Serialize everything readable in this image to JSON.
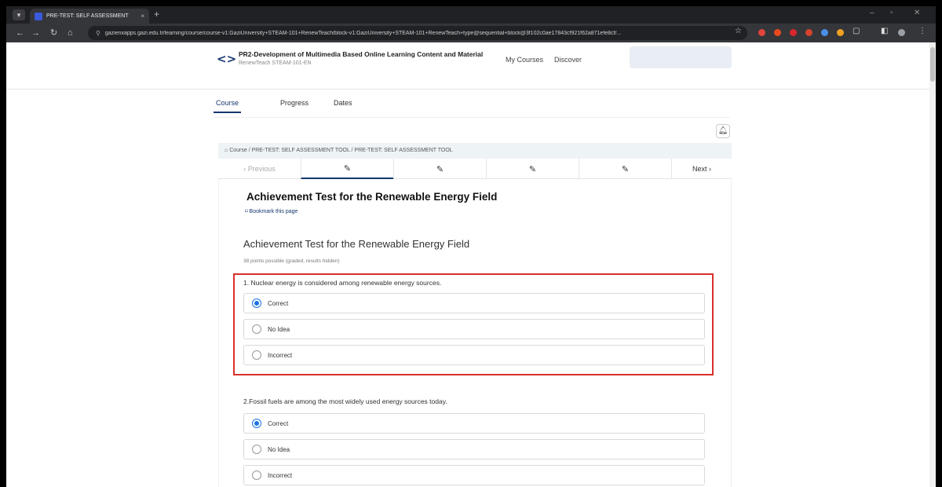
{
  "browser": {
    "tab_title": "PRE-TEST: SELF ASSESSMENT",
    "tab_close": "×",
    "new_tab": "+",
    "url": "gazienxapps.gazi.edu.tr/learning/course/course-v1:GaziUniversity+STEAM-101+RenewTeach/block-v1:GaziUniversity+STEAM-101+RenewTeach+type@sequential+block@3f102c0ae17843cf921f62a871efe8cf/..."
  },
  "header": {
    "logo": "<>",
    "course_title": "PR2-Development of Multimedia Based Online Learning Content and Material",
    "course_code": "RenewTeach STEAM-101-EN",
    "links": [
      "My Courses",
      "Discover"
    ]
  },
  "course_tabs": [
    "Course",
    "Progress",
    "Dates"
  ],
  "breadcrumb": "Course  /  PRE-TEST: SELF ASSESSMENT TOOL  /  PRE-TEST: SELF ASSESSMENT TOOL",
  "unit_nav": {
    "previous": "Previous",
    "next": "Next"
  },
  "unit": {
    "title": "Achievement Test for the Renewable Energy Field",
    "bookmark": "Bookmark this page"
  },
  "problem": {
    "title": "Achievement Test for the Renewable Energy Field",
    "points": "38 points possible (graded, results hidden)",
    "questions": [
      {
        "text": "1. Nuclear energy is considered among renewable energy sources.",
        "options": [
          "Correct",
          "No Idea",
          "Incorrect"
        ],
        "selected": "Correct"
      },
      {
        "text": "2.Fossil fuels are among the most widely used energy sources today.",
        "options": [
          "Correct",
          "No Idea",
          "Incorrect"
        ],
        "selected": "Correct"
      }
    ]
  },
  "colors": {
    "brand": "#15376d",
    "highlight": "#d9302c",
    "radio_selected": "#1a73e8"
  }
}
